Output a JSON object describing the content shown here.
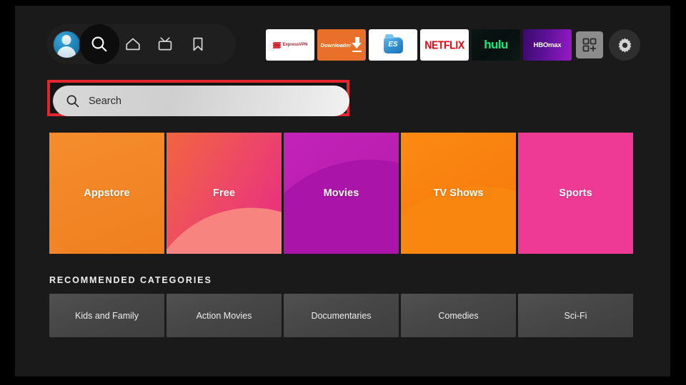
{
  "colors": {
    "page_bg": "#000000",
    "plate_bg": "#1a1a1a",
    "accent_red": "#e1262e",
    "netflix_red": "#e50914",
    "hulu_green": "#1ce783",
    "downloader_orange": "#e8702a",
    "avatar_blue": "#1b7fb5"
  },
  "topbar": {
    "nav": [
      {
        "name": "profile",
        "icon": "profile-avatar-icon",
        "label": "Profile"
      },
      {
        "name": "search",
        "icon": "search-icon",
        "label": "Search"
      },
      {
        "name": "home",
        "icon": "home-icon",
        "label": "Home"
      },
      {
        "name": "live",
        "icon": "live-tv-icon",
        "label": "Live"
      },
      {
        "name": "bookmark",
        "icon": "bookmark-icon",
        "label": "Your Stuff"
      }
    ],
    "apps": [
      {
        "name": "expressvpn",
        "label": "ExpressVPN"
      },
      {
        "name": "downloader",
        "label": "Downloader"
      },
      {
        "name": "es-file-explorer",
        "label": "ES"
      },
      {
        "name": "netflix",
        "label": "NETFLIX"
      },
      {
        "name": "hulu",
        "label": "hulu"
      },
      {
        "name": "hbomax",
        "label": "HBOmax"
      }
    ],
    "apps_grid_label": "Apps",
    "settings_label": "Settings"
  },
  "search": {
    "placeholder": "Search",
    "value": "",
    "highlighted": true
  },
  "tiles": [
    {
      "label": "Appstore",
      "class": "tile-appstore",
      "name": "tile-appstore"
    },
    {
      "label": "Free",
      "class": "tile-free",
      "name": "tile-free"
    },
    {
      "label": "Movies",
      "class": "tile-movies",
      "name": "tile-movies"
    },
    {
      "label": "TV Shows",
      "class": "tile-tvshows",
      "name": "tile-tv-shows"
    },
    {
      "label": "Sports",
      "class": "tile-sports",
      "name": "tile-sports"
    }
  ],
  "recommended": {
    "heading": "RECOMMENDED CATEGORIES",
    "items": [
      {
        "label": "Kids and Family",
        "name": "rec-tile-kids-and-family"
      },
      {
        "label": "Action Movies",
        "name": "rec-tile-action-movies"
      },
      {
        "label": "Documentaries",
        "name": "rec-tile-documentaries"
      },
      {
        "label": "Comedies",
        "name": "rec-tile-comedies"
      },
      {
        "label": "Sci-Fi",
        "name": "rec-tile-sci-fi"
      }
    ]
  }
}
